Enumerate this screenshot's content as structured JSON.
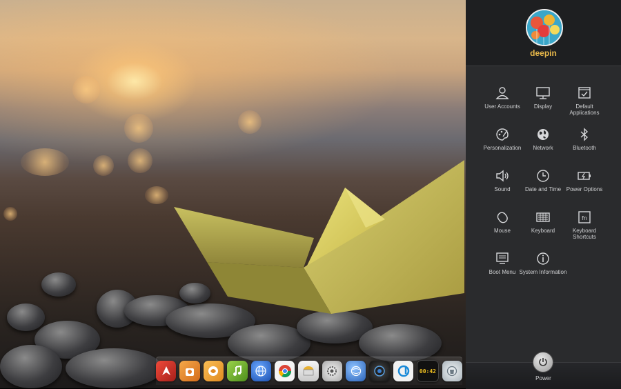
{
  "user": {
    "name": "deepin"
  },
  "control_center": {
    "items": [
      {
        "label": "User Accounts",
        "icon": "user-icon"
      },
      {
        "label": "Display",
        "icon": "monitor-icon"
      },
      {
        "label": "Default Applications",
        "icon": "default-apps-icon"
      },
      {
        "label": "Personalization",
        "icon": "palette-icon"
      },
      {
        "label": "Network",
        "icon": "globe-icon"
      },
      {
        "label": "Bluetooth",
        "icon": "bluetooth-icon"
      },
      {
        "label": "Sound",
        "icon": "speaker-icon"
      },
      {
        "label": "Date and Time",
        "icon": "clock-icon"
      },
      {
        "label": "Power Options",
        "icon": "battery-icon"
      },
      {
        "label": "Mouse",
        "icon": "mouse-icon"
      },
      {
        "label": "Keyboard",
        "icon": "keyboard-icon"
      },
      {
        "label": "Keyboard Shortcuts",
        "icon": "fn-key-icon"
      },
      {
        "label": "Boot Menu",
        "icon": "boot-screen-icon"
      },
      {
        "label": "System Information",
        "icon": "info-icon"
      }
    ],
    "power_label": "Power"
  },
  "dock": {
    "items": [
      {
        "name": "launcher-icon",
        "color": "#d8322e"
      },
      {
        "name": "app-store-icon",
        "color": "#e88a2a"
      },
      {
        "name": "game-center-icon",
        "color": "#f2a23a"
      },
      {
        "name": "music-player-icon",
        "color": "#7dbb2e"
      },
      {
        "name": "browser-globe-icon",
        "color": "#2f6fd6"
      },
      {
        "name": "chrome-icon",
        "color": "#ffffff"
      },
      {
        "name": "screenshot-icon",
        "color": "#e8e8e8"
      },
      {
        "name": "settings-icon",
        "color": "#cfcfcf"
      },
      {
        "name": "network-manager-icon",
        "color": "#3a7fd0"
      },
      {
        "name": "camera-icon",
        "color": "#2b2b2b"
      },
      {
        "name": "deepin-movie-icon",
        "color": "#eeeeee"
      },
      {
        "name": "clock-app-icon",
        "color": "#1a1a1a"
      },
      {
        "name": "trash-icon",
        "color": "#cfd6dc"
      }
    ],
    "clock_text": "00:42"
  }
}
